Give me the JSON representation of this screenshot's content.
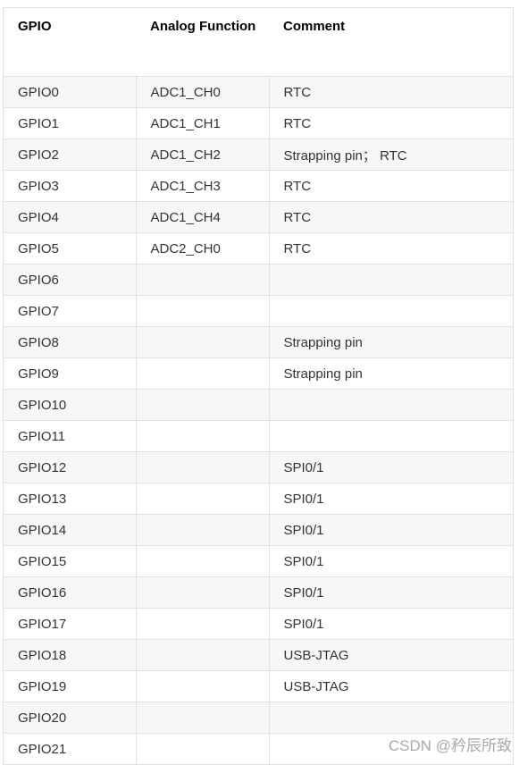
{
  "table": {
    "headers": [
      "GPIO",
      "Analog Function",
      "Comment"
    ],
    "rows": [
      [
        "GPIO0",
        "ADC1_CH0",
        "RTC"
      ],
      [
        "GPIO1",
        "ADC1_CH1",
        "RTC"
      ],
      [
        "GPIO2",
        "ADC1_CH2",
        "Strapping pin； RTC"
      ],
      [
        "GPIO3",
        "ADC1_CH3",
        "RTC"
      ],
      [
        "GPIO4",
        "ADC1_CH4",
        "RTC"
      ],
      [
        "GPIO5",
        "ADC2_CH0",
        "RTC"
      ],
      [
        "GPIO6",
        "",
        ""
      ],
      [
        "GPIO7",
        "",
        ""
      ],
      [
        "GPIO8",
        "",
        "Strapping pin"
      ],
      [
        "GPIO9",
        "",
        "Strapping pin"
      ],
      [
        "GPIO10",
        "",
        ""
      ],
      [
        "GPIO11",
        "",
        ""
      ],
      [
        "GPIO12",
        "",
        "SPI0/1"
      ],
      [
        "GPIO13",
        "",
        "SPI0/1"
      ],
      [
        "GPIO14",
        "",
        "SPI0/1"
      ],
      [
        "GPIO15",
        "",
        "SPI0/1"
      ],
      [
        "GPIO16",
        "",
        "SPI0/1"
      ],
      [
        "GPIO17",
        "",
        "SPI0/1"
      ],
      [
        "GPIO18",
        "",
        "USB-JTAG"
      ],
      [
        "GPIO19",
        "",
        "USB-JTAG"
      ],
      [
        "GPIO20",
        "",
        ""
      ],
      [
        "GPIO21",
        "",
        ""
      ]
    ]
  },
  "watermark": "CSDN @矜辰所致"
}
